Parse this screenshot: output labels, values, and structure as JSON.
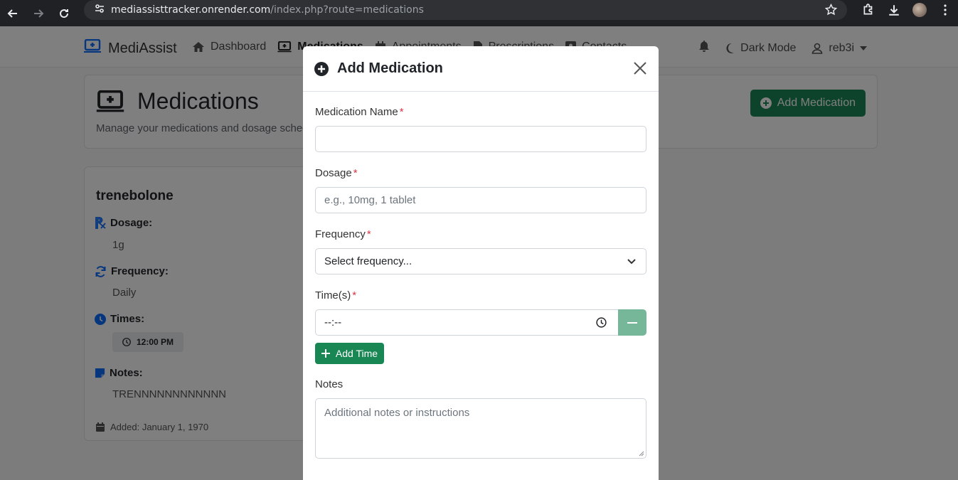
{
  "browser": {
    "url_host": "mediassisttracker.onrender.com",
    "url_path": "/index.php?route=medications"
  },
  "navbar": {
    "brand": "MediAssist",
    "links": [
      "Dashboard",
      "Medications",
      "Appointments",
      "Prescriptions",
      "Contacts"
    ],
    "dark_mode": "Dark Mode",
    "user": "reb3i"
  },
  "page": {
    "title": "Medications",
    "subtitle": "Manage your medications and dosage schedules",
    "add_button": "Add Medication"
  },
  "card": {
    "name": "trenebolone",
    "dosage_label": "Dosage:",
    "dosage": "1g",
    "frequency_label": "Frequency:",
    "frequency": "Daily",
    "times_label": "Times:",
    "time": "12:00 PM",
    "notes_label": "Notes:",
    "notes": "TRENNNNNNNNNNNN",
    "added": "Added: January 1, 1970"
  },
  "modal": {
    "title": "Add Medication",
    "name_label": "Medication Name",
    "dosage_label": "Dosage",
    "dosage_placeholder": "e.g., 10mg, 1 tablet",
    "frequency_label": "Frequency",
    "frequency_value": "Select frequency...",
    "times_label": "Time(s)",
    "time_value": "--:--",
    "add_time": "Add Time",
    "notes_label": "Notes",
    "notes_placeholder": "Additional notes or instructions",
    "required_mark": "*"
  }
}
